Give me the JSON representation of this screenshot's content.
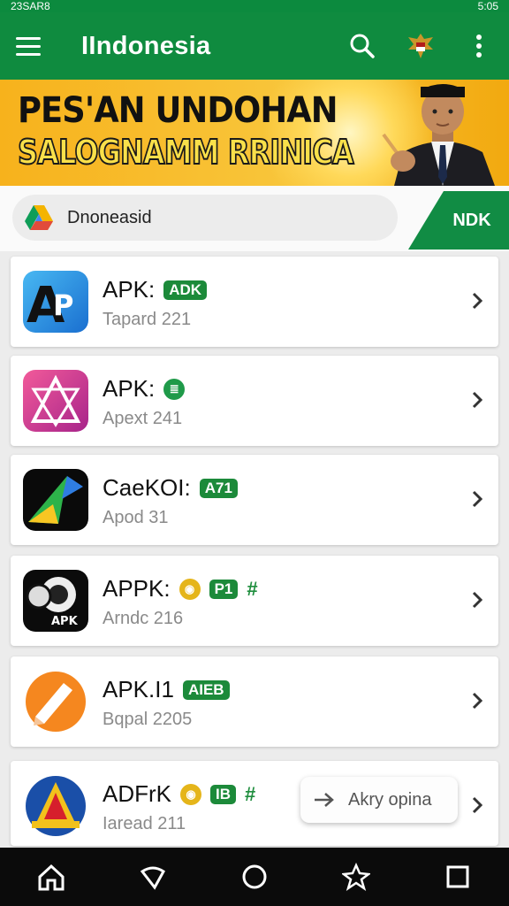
{
  "status_bar": {
    "left": "23SAR8",
    "right": "5:05"
  },
  "app_bar": {
    "title": "IIndonesia",
    "icons": [
      "menu-icon",
      "search-icon",
      "garuda-emblem-icon",
      "more-vert-icon"
    ]
  },
  "banner": {
    "line1": "PES'AN UNDOHAN",
    "line2": "SALOGNAMM RRINICA"
  },
  "search": {
    "value": "Dnoneasid",
    "action_label": "NDK"
  },
  "apps": [
    {
      "name": "APK:",
      "badges": [
        {
          "type": "tag",
          "text": "ADK"
        }
      ],
      "subtitle": "Tapard 221",
      "icon_colors": [
        "#3aa6e8",
        "#1565c0"
      ]
    },
    {
      "name": "APK:",
      "badges": [
        {
          "type": "circle",
          "text": "≣"
        }
      ],
      "subtitle": "Apext 241",
      "icon_colors": [
        "#ef4a8d",
        "#b02a86"
      ]
    },
    {
      "name": "CaeKOI:",
      "badges": [
        {
          "type": "tag",
          "text": "A71"
        }
      ],
      "subtitle": "Apod 31",
      "icon_colors": [
        "#000000",
        "#2a2a2a"
      ]
    },
    {
      "name": "APPK:",
      "badges": [
        {
          "type": "coin",
          "text": "◉"
        },
        {
          "type": "tag",
          "text": "P1"
        },
        {
          "type": "hash",
          "text": "#"
        }
      ],
      "subtitle": "Arndc 216",
      "icon_colors": [
        "#0b0b0b",
        "#222222"
      ]
    },
    {
      "name": "APK.I1",
      "badges": [
        {
          "type": "tag",
          "text": "AIEB"
        }
      ],
      "subtitle": "Bqpal 2205",
      "icon_colors": [
        "#ff8a1c",
        "#e4620a"
      ]
    },
    {
      "name": "ADFrK",
      "badges": [
        {
          "type": "coin",
          "text": "◉"
        },
        {
          "type": "tag",
          "text": "IB"
        },
        {
          "type": "hash",
          "text": "#"
        }
      ],
      "subtitle": "Iaread 211",
      "icon_colors": [
        "#d61f2c",
        "#1a57b8"
      ]
    }
  ],
  "toast": {
    "label": "Akry opina"
  },
  "nav_bar": {
    "items": [
      "home-icon",
      "back-icon",
      "circle-home-icon",
      "star-icon",
      "recents-icon"
    ]
  }
}
